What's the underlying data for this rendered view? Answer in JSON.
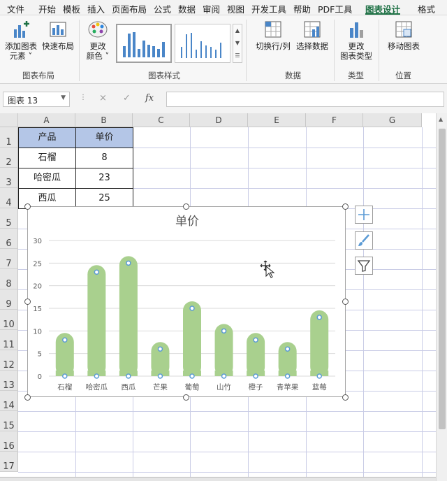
{
  "tabs": [
    "文件",
    "开始",
    "模板",
    "插入",
    "页面布局",
    "公式",
    "数据",
    "审阅",
    "视图",
    "开发工具",
    "帮助",
    "PDF工具",
    "图表设计",
    "格式"
  ],
  "active_tab": "图表设计",
  "ribbon": {
    "add_element": "添加图表元素",
    "add_element_l1": "添加图表",
    "add_element_l2": "元素 ˅",
    "quick_layout": "快速布局",
    "change_color_l1": "更改",
    "change_color_l2": "颜色 ˅",
    "switch_rowcol": "切换行/列",
    "select_data": "选择数据",
    "change_type_l1": "更改",
    "change_type_l2": "图表类型",
    "move_chart": "移动图表",
    "groups": {
      "layout": "图表布局",
      "styles": "图表样式",
      "data": "数据",
      "type": "类型",
      "location": "位置"
    }
  },
  "namebox": "图表 13",
  "formula_symbols": {
    "cancel": "×",
    "confirm": "✓",
    "fx": "fx"
  },
  "columns": [
    "A",
    "B",
    "C",
    "D",
    "E",
    "F",
    "G"
  ],
  "rows": [
    "1",
    "2",
    "3",
    "4",
    "5",
    "6",
    "7",
    "8",
    "9",
    "10",
    "11",
    "12",
    "13",
    "14",
    "15",
    "16",
    "17"
  ],
  "table": {
    "headers": [
      "产品",
      "单价"
    ],
    "rows": [
      [
        "石榴",
        "8"
      ],
      [
        "哈密瓜",
        "23"
      ],
      [
        "西瓜",
        "25"
      ]
    ]
  },
  "colors": {
    "bar": "#a9d08e",
    "header_fill": "#b4c6e7",
    "marker": "#5b9bd5",
    "accent": "#1e7145"
  },
  "chart_data": {
    "type": "bar",
    "title": "单价",
    "categories": [
      "石榴",
      "哈密瓜",
      "西瓜",
      "芒果",
      "葡萄",
      "山竹",
      "橙子",
      "青苹果",
      "蓝莓"
    ],
    "values": [
      8,
      23,
      25,
      6,
      15,
      10,
      8,
      6,
      13
    ],
    "ylim": [
      0,
      30
    ],
    "yticks": [
      "0",
      "5",
      "10",
      "15",
      "20",
      "25",
      "30"
    ],
    "grid": true,
    "legend": "none"
  },
  "side_buttons": [
    "plus-icon",
    "brush-icon",
    "filter-icon"
  ]
}
